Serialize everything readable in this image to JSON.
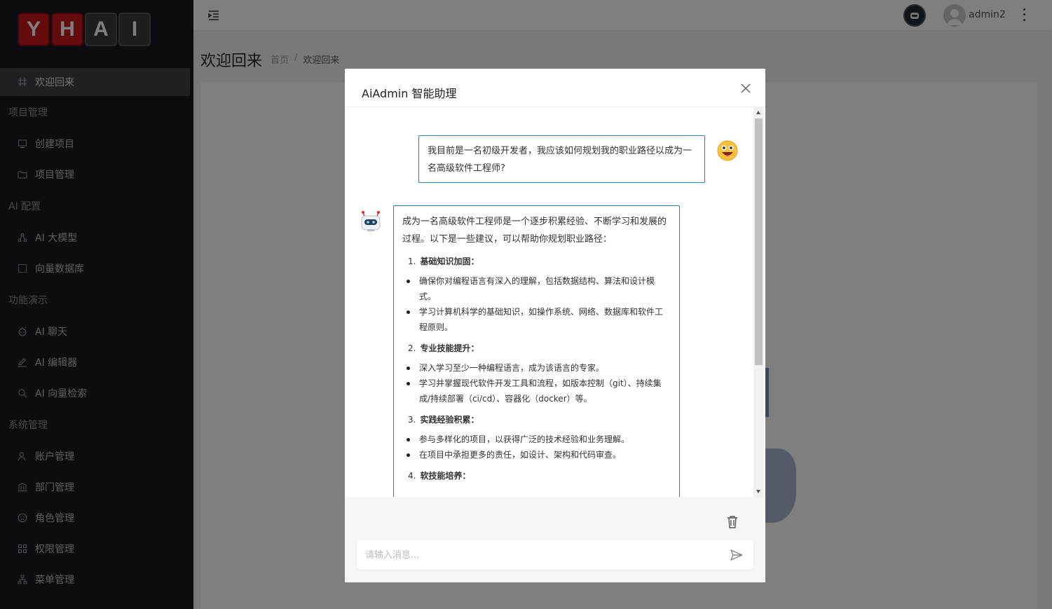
{
  "logo": {
    "letters": [
      "Y",
      "H",
      "A",
      "I"
    ]
  },
  "sidebar": {
    "items": [
      {
        "type": "item",
        "label": "欢迎回来",
        "icon": "hash-icon",
        "active": true
      },
      {
        "type": "group",
        "label": "项目管理"
      },
      {
        "type": "item",
        "label": "创建项目",
        "icon": "monitor-icon"
      },
      {
        "type": "item",
        "label": "项目管理",
        "icon": "folder-icon"
      },
      {
        "type": "group",
        "label": "AI 配置"
      },
      {
        "type": "item",
        "label": "AI 大模型",
        "icon": "nodes-icon"
      },
      {
        "type": "item",
        "label": "向量数据库",
        "icon": "grid-icon"
      },
      {
        "type": "group",
        "label": "功能演示"
      },
      {
        "type": "item",
        "label": "AI 聊天",
        "icon": "chat-icon"
      },
      {
        "type": "item",
        "label": "AI 编辑器",
        "icon": "edit-icon"
      },
      {
        "type": "item",
        "label": "AI 向量检索",
        "icon": "search-icon"
      },
      {
        "type": "group",
        "label": "系统管理"
      },
      {
        "type": "item",
        "label": "账户管理",
        "icon": "user-icon"
      },
      {
        "type": "item",
        "label": "部门管理",
        "icon": "bank-icon"
      },
      {
        "type": "item",
        "label": "角色管理",
        "icon": "smile-icon"
      },
      {
        "type": "item",
        "label": "权限管理",
        "icon": "apps-icon"
      },
      {
        "type": "item",
        "label": "菜单管理",
        "icon": "tree-icon"
      }
    ]
  },
  "header": {
    "username": "admin2"
  },
  "page": {
    "title": "欢迎回来",
    "breadcrumb": [
      "首页",
      "/",
      "欢迎回来"
    ]
  },
  "dialog": {
    "title": "AiAdmin 智能助理",
    "user_message": "我目前是一名初级开发者，我应该如何规划我的职业路径以成为一名高级软件工程师?",
    "bot_intro": "成为一名高级软件工程师是一个逐步积累经验、不断学习和发展的过程。以下是一些建议，可以帮助你规划职业路径：",
    "sections": [
      {
        "num": "1.",
        "title": "基础知识加固：",
        "points": [
          "确保你对编程语言有深入的理解，包括数据结构、算法和设计模式。",
          "学习计算机科学的基础知识，如操作系统、网络、数据库和软件工程原则。"
        ]
      },
      {
        "num": "2.",
        "title": "专业技能提升：",
        "points": [
          "深入学习至少一种编程语言，成为该语言的专家。",
          "学习并掌握现代软件开发工具和流程，如版本控制（git）、持续集成/持续部署（ci/cd）、容器化（docker）等。"
        ]
      },
      {
        "num": "3.",
        "title": "实践经验积累：",
        "points": [
          "参与多样化的项目，以获得广泛的技术经验和业务理解。",
          "在项目中承担更多的责任，如设计、架构和代码审查。"
        ]
      },
      {
        "num": "4.",
        "title": "软技能培养：",
        "points": []
      }
    ],
    "input_placeholder": "请输入消息..."
  }
}
